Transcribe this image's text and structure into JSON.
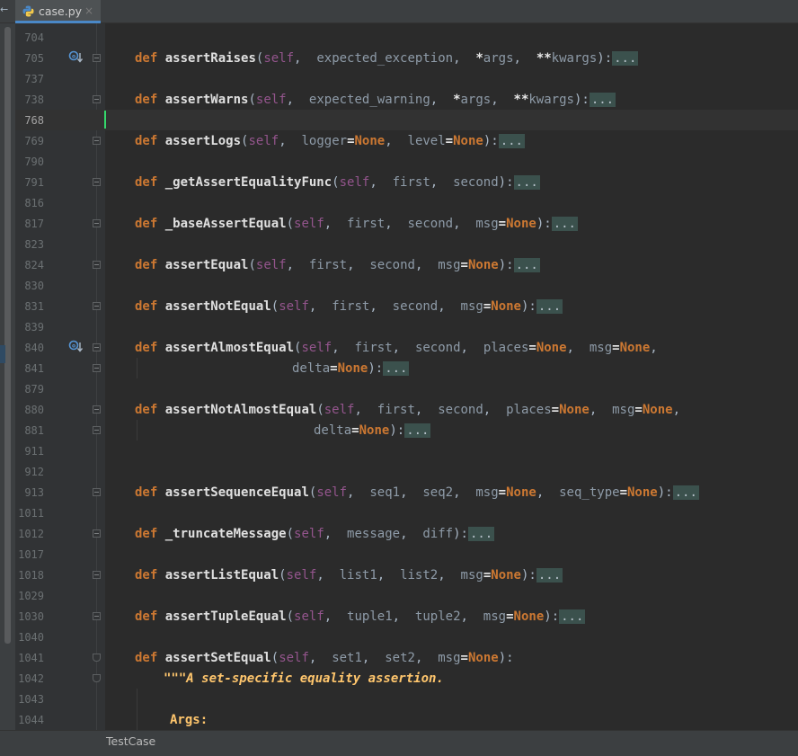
{
  "tab": {
    "filename": "case.py",
    "close": "×",
    "back": "←"
  },
  "breadcrumb": {
    "item": "TestCase"
  },
  "lines": [
    {
      "n": "704"
    },
    {
      "n": "705",
      "def": "def",
      "name": "assertRaises",
      "args": [
        "self",
        "expected_exception",
        "*args",
        "**kwargs"
      ],
      "fold": "..."
    },
    {
      "n": "737"
    },
    {
      "n": "738",
      "def": "def",
      "name": "assertWarns",
      "args": [
        "self",
        "expected_warning",
        "*args",
        "**kwargs"
      ],
      "fold": "..."
    },
    {
      "n": "768"
    },
    {
      "n": "769",
      "def": "def",
      "name": "assertLogs",
      "fold": "..."
    },
    {
      "n": "790"
    },
    {
      "n": "791",
      "def": "def",
      "name": "_getAssertEqualityFunc",
      "fold": "..."
    },
    {
      "n": "816"
    },
    {
      "n": "817",
      "def": "def",
      "name": "_baseAssertEqual",
      "fold": "..."
    },
    {
      "n": "823"
    },
    {
      "n": "824",
      "def": "def",
      "name": "assertEqual",
      "fold": "..."
    },
    {
      "n": "830"
    },
    {
      "n": "831",
      "def": "def",
      "name": "assertNotEqual",
      "fold": "..."
    },
    {
      "n": "839"
    },
    {
      "n": "840",
      "def": "def",
      "name": "assertAlmostEqual"
    },
    {
      "n": "841",
      "cont": "delta",
      "fold": "..."
    },
    {
      "n": "879"
    },
    {
      "n": "880",
      "def": "def",
      "name": "assertNotAlmostEqual"
    },
    {
      "n": "881",
      "cont": "delta",
      "fold": "..."
    },
    {
      "n": "911"
    },
    {
      "n": "912"
    },
    {
      "n": "913",
      "def": "def",
      "name": "assertSequenceEqual",
      "fold": "..."
    },
    {
      "n": "1011"
    },
    {
      "n": "1012",
      "def": "def",
      "name": "_truncateMessage",
      "fold": "..."
    },
    {
      "n": "1017"
    },
    {
      "n": "1018",
      "def": "def",
      "name": "assertListEqual",
      "fold": "..."
    },
    {
      "n": "1029"
    },
    {
      "n": "1030",
      "def": "def",
      "name": "assertTupleEqual",
      "fold": "..."
    },
    {
      "n": "1040"
    },
    {
      "n": "1041",
      "def": "def",
      "name": "assertSetEqual"
    },
    {
      "n": "1042",
      "doc": "\"\"\"A set-specific equality assertion."
    },
    {
      "n": "1043"
    },
    {
      "n": "1044",
      "doc": "Args:"
    }
  ],
  "tokens": {
    "self": "self",
    "none": "None",
    "eq": "=",
    "comma": ", ",
    "lparen": "(",
    "rparen": ")",
    "colon": ":",
    "star": "*",
    "dstar": "**",
    "args": "args",
    "kwargs": "kwargs",
    "expected_exception": "expected_exception",
    "expected_warning": "expected_warning",
    "logger": "logger",
    "level": "level",
    "first": "first",
    "second": "second",
    "msg": "msg",
    "places": "places",
    "delta": "delta",
    "seq1": "seq1",
    "seq2": "seq2",
    "seq_type": "seq_type",
    "message": "message",
    "diff": "diff",
    "list1": "list1",
    "list2": "list2",
    "tuple1": "tuple1",
    "tuple2": "tuple2",
    "set1": "set1",
    "set2": "set2",
    "ellipsis": "..."
  },
  "colors": {
    "keyword": "#cc7832",
    "function": "#ffc66d",
    "self": "#94558d",
    "caret": "#35d86b",
    "background": "#2b2b2b",
    "gutter": "#313335"
  }
}
